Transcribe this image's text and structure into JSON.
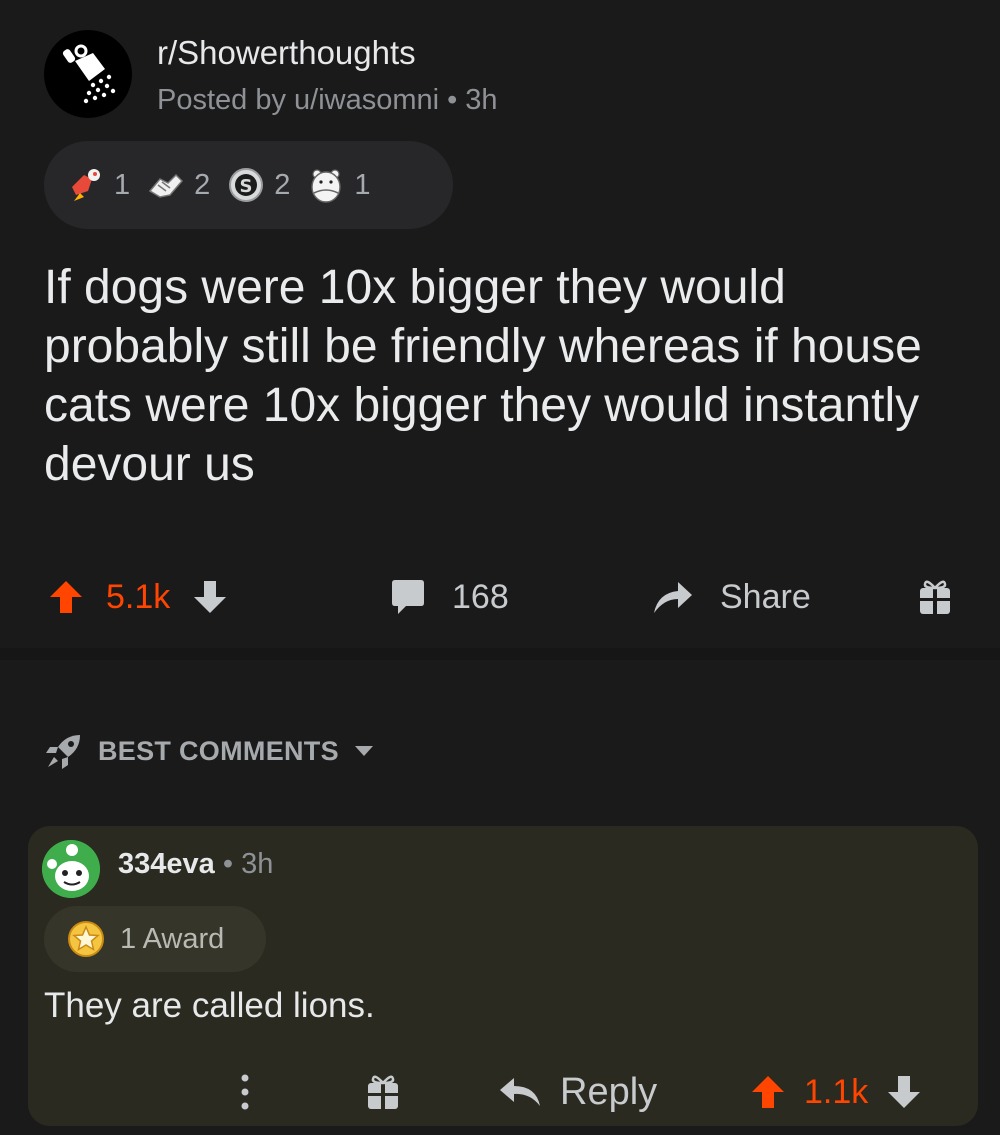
{
  "post": {
    "subreddit": "r/Showerthoughts",
    "posted_by": "Posted by u/iwasomni",
    "time": "3h",
    "awards": [
      {
        "icon": "rocket-like-award-icon",
        "count": "1"
      },
      {
        "icon": "handshake-award-icon",
        "count": "2"
      },
      {
        "icon": "silver-coin-award-icon",
        "count": "2"
      },
      {
        "icon": "bear-hug-award-icon",
        "count": "1"
      }
    ],
    "title": "If dogs were 10x bigger they would probably still be friendly whereas if house cats were 10x bigger they would instantly devour us",
    "score": "5.1k",
    "comments": "168",
    "share_label": "Share"
  },
  "sort": {
    "label": "BEST COMMENTS"
  },
  "comment": {
    "author": "334eva",
    "time": "3h",
    "award_label": "1 Award",
    "body": "They are called lions.",
    "reply_label": "Reply",
    "score": "1.1k"
  },
  "colors": {
    "background": "#1a1a1b",
    "upvote_orange": "#ff4500",
    "comment_highlight": "#2b2a20",
    "pill": "#272729"
  }
}
